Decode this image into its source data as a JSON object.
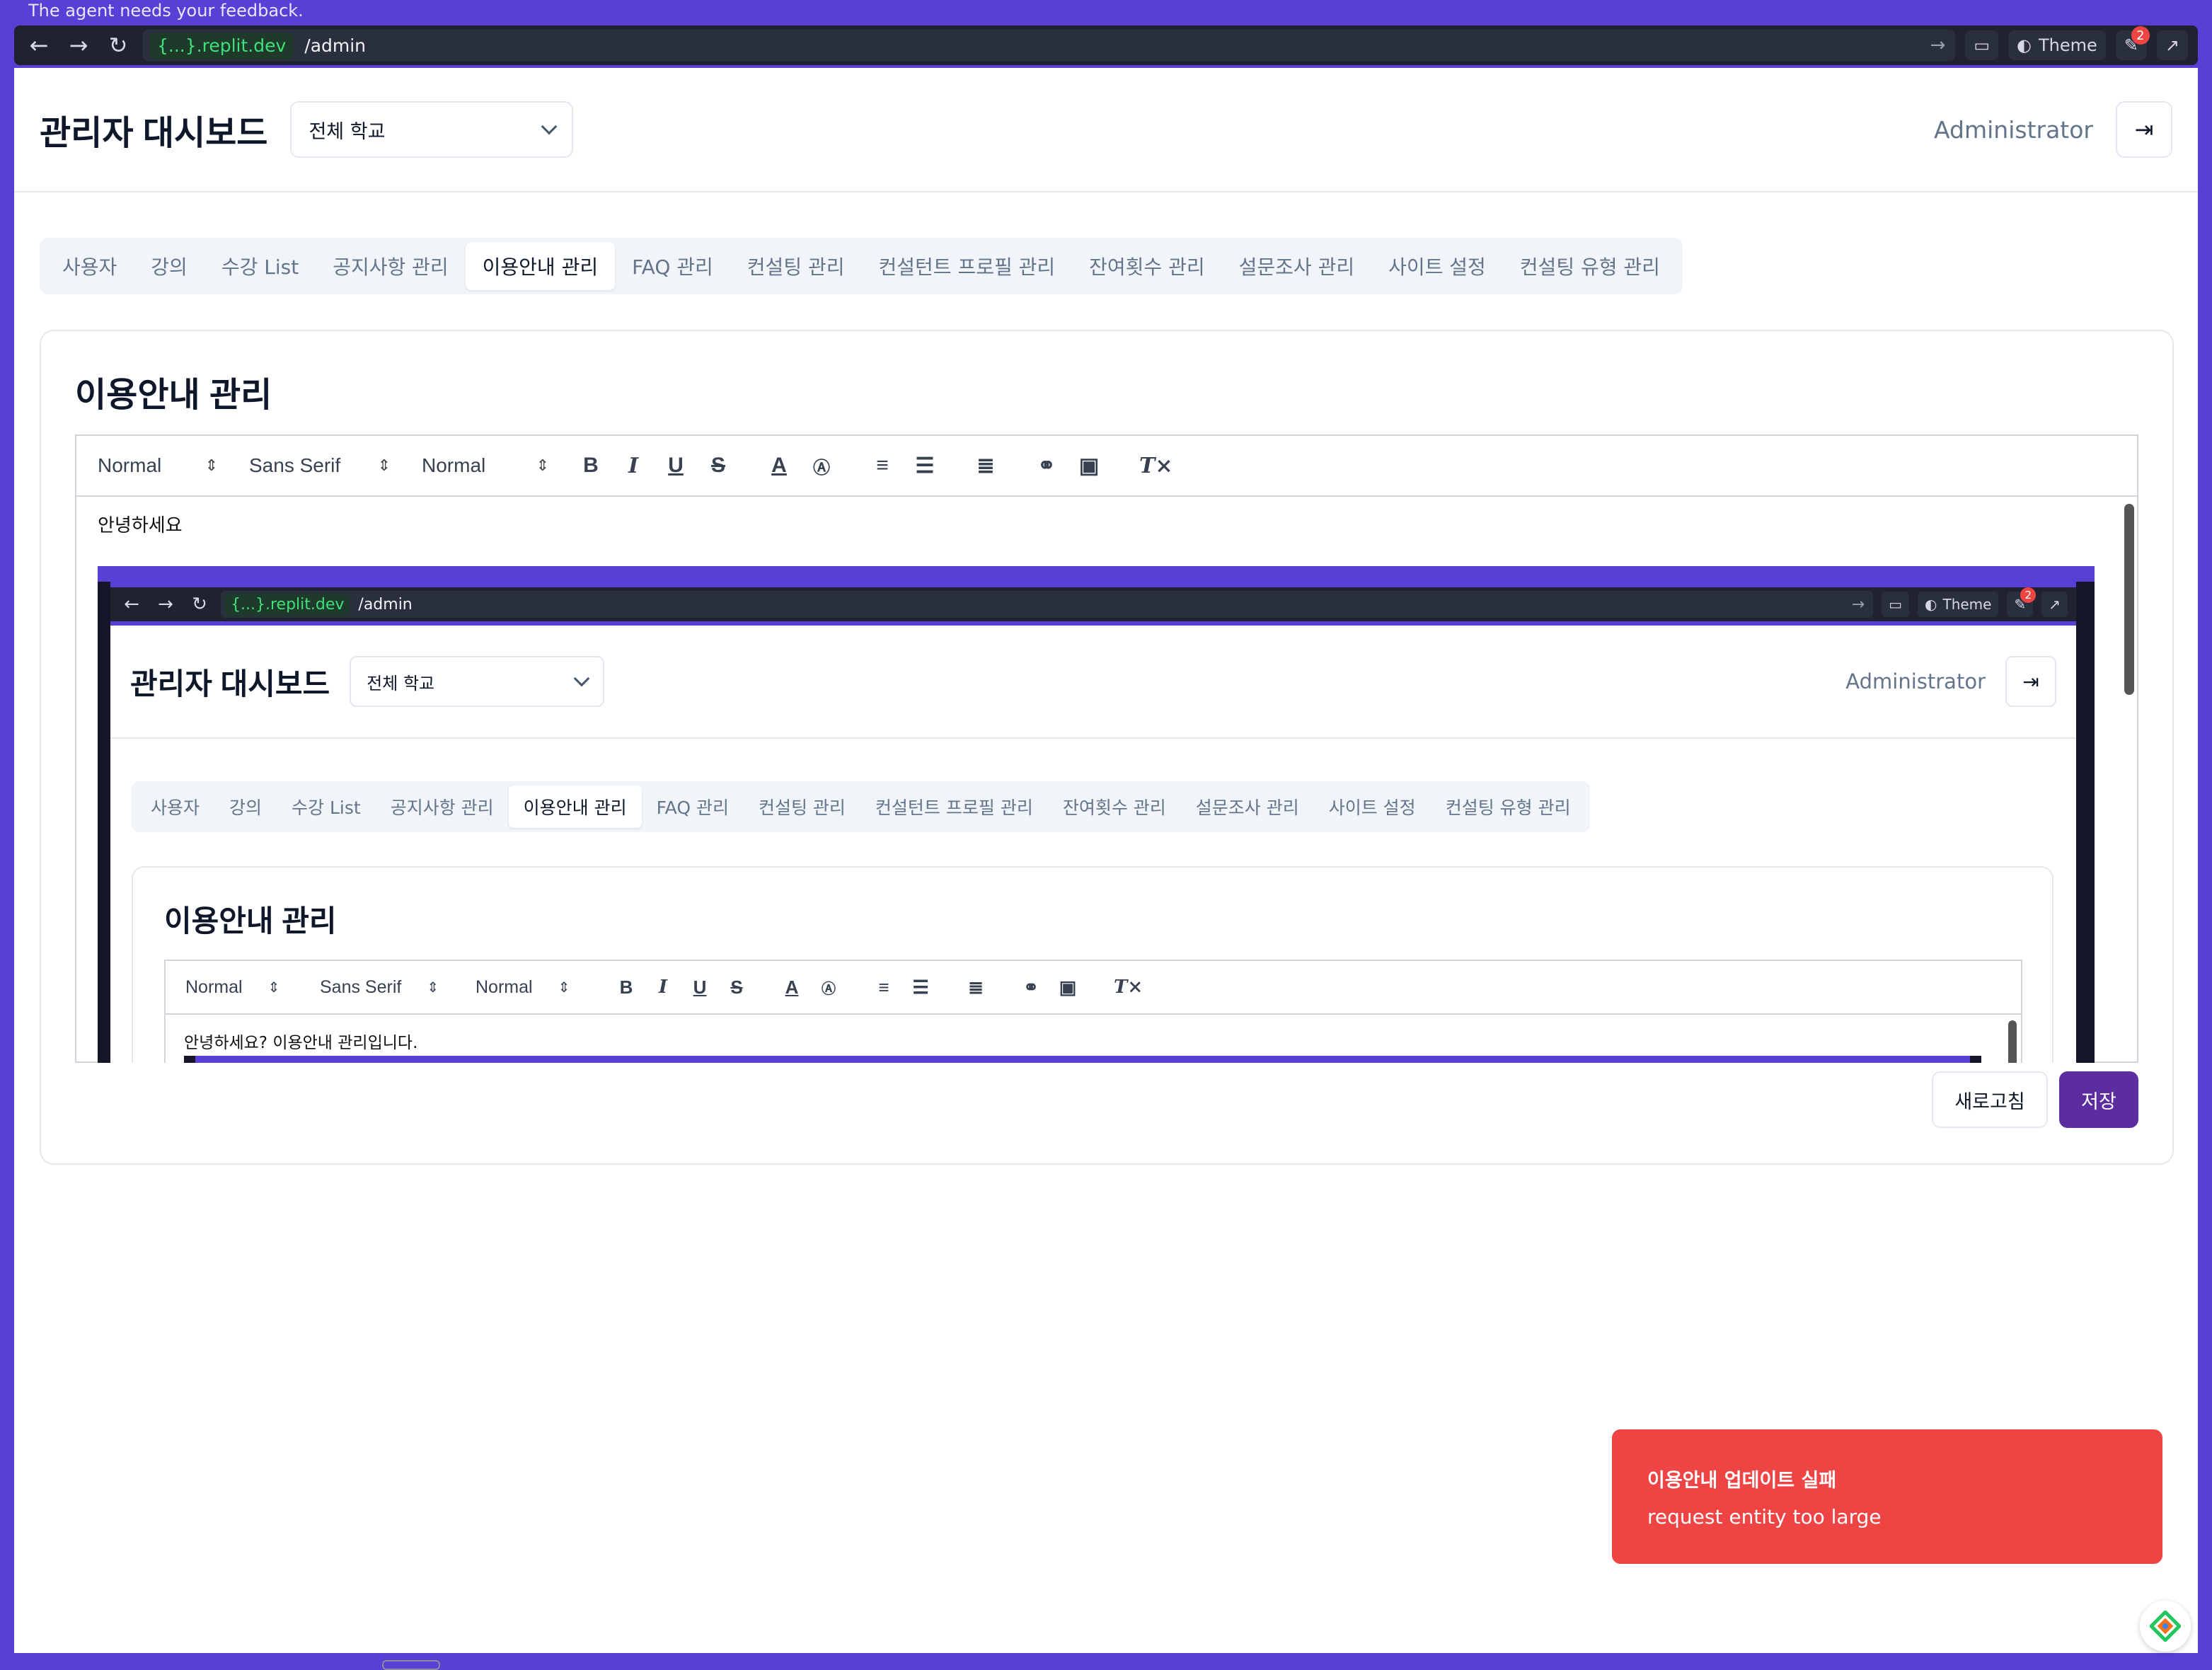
{
  "os": {
    "top_text": "The agent needs your feedback."
  },
  "browser": {
    "domain": "{...}.replit.dev",
    "path": "/admin",
    "theme_label": "Theme",
    "badge_count": "2"
  },
  "header": {
    "title": "관리자 대시보드",
    "school_select": "전체 학교",
    "user": "Administrator"
  },
  "tabs": [
    {
      "label": "사용자"
    },
    {
      "label": "강의"
    },
    {
      "label": "수강 List"
    },
    {
      "label": "공지사항 관리"
    },
    {
      "label": "이용안내 관리",
      "active": true
    },
    {
      "label": "FAQ 관리"
    },
    {
      "label": "컨설팅 관리"
    },
    {
      "label": "컨설턴트 프로필 관리"
    },
    {
      "label": "잔여횟수 관리"
    },
    {
      "label": "설문조사 관리"
    },
    {
      "label": "사이트 설정"
    },
    {
      "label": "컨설팅 유형 관리"
    }
  ],
  "card": {
    "title": "이용안내 관리"
  },
  "toolbar": {
    "heading": "Normal",
    "font": "Sans Serif",
    "size": "Normal"
  },
  "editor": {
    "text": "안녕하세요"
  },
  "embed": {
    "domain": "{...}.replit.dev",
    "path": "/admin",
    "theme_label": "Theme",
    "badge_count": "2",
    "title": "관리자 대시보드",
    "school_select": "전체 학교",
    "user": "Administrator",
    "card_title": "이용안내 관리",
    "editor_text": "안녕하세요? 이용안내 관리입니다."
  },
  "actions": {
    "refresh": "새로고침",
    "save": "저장"
  },
  "toast": {
    "title": "이용안내 업데이트 실패",
    "message": "request entity too large",
    "color": "#ef4444"
  },
  "colors": {
    "accent": "#5b2d9e",
    "frame": "#5a3fd6"
  }
}
